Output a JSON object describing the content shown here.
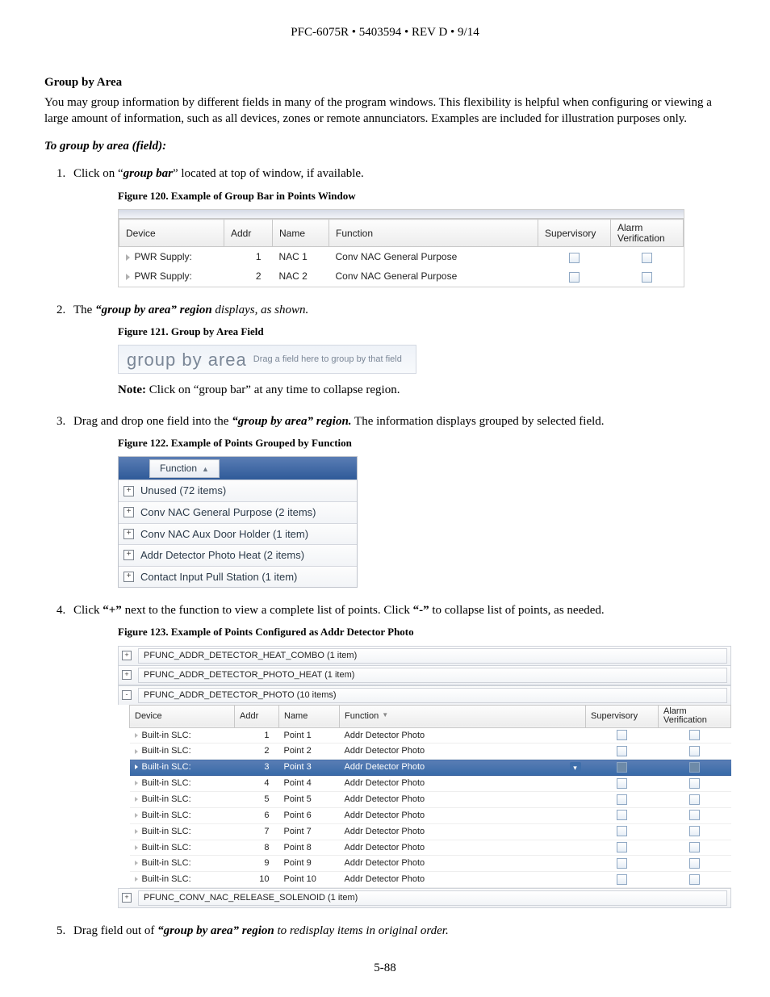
{
  "header": "PFC-6075R • 5403594 • REV D • 9/14",
  "section_title": "Group by Area",
  "intro_para": "You may group information by different fields in many of the program windows. This flexibility is helpful when configuring or viewing a large amount of information, such as all devices, zones or remote annunciators. Examples are included for illustration purposes only.",
  "subheading": "To group by area (field):",
  "step1_a": "Click on “",
  "step1_b": "group bar",
  "step1_c": "” located at top of window, if available.",
  "fig120_title": "Figure 120. Example of Group Bar in Points Window",
  "fig120": {
    "cols": [
      "Device",
      "Addr",
      "Name",
      "Function",
      "Supervisory",
      "Alarm Verification"
    ],
    "rows": [
      {
        "device": "PWR Supply:",
        "addr": "1",
        "name": "NAC 1",
        "function": "Conv NAC General Purpose"
      },
      {
        "device": "PWR Supply:",
        "addr": "2",
        "name": "NAC 2",
        "function": "Conv NAC General Purpose"
      }
    ]
  },
  "step2_a": "The ",
  "step2_b": "“group by area” region",
  "step2_c": " displays, as shown.",
  "fig121_title": "Figure 121. Group by Area Field",
  "fig121_big": "group by area",
  "fig121_small": "Drag a field here to group by that field",
  "note_prefix": "Note:",
  "note_text": " Click on “group bar” at any time to collapse region.",
  "step3_a": "Drag and drop one field into the ",
  "step3_b": "“group by area” region.",
  "step3_c": " The information displays grouped by selected field.",
  "fig122_title": "Figure 122. Example of Points Grouped by Function",
  "fig122": {
    "chip": "Function",
    "rows": [
      "Unused (72 items)",
      "Conv NAC General Purpose (2 items)",
      "Conv NAC Aux Door Holder (1 item)",
      "Addr Detector Photo Heat (2 items)",
      "Contact Input Pull Station (1 item)"
    ]
  },
  "step4_a": "Click ",
  "step4_plus": "“+”",
  "step4_b": " next to the function to view a complete list of points. Click ",
  "step4_minus": "“-”",
  "step4_c": " to collapse list of points, as needed.",
  "fig123_title": "Figure 123. Example of Points Configured as Addr Detector Photo",
  "fig123": {
    "groups_top": [
      "PFUNC_ADDR_DETECTOR_HEAT_COMBO (1 item)",
      "PFUNC_ADDR_DETECTOR_PHOTO_HEAT (1 item)"
    ],
    "open_group": "PFUNC_ADDR_DETECTOR_PHOTO (10 items)",
    "cols": [
      "Device",
      "Addr",
      "Name",
      "Function",
      "Supervisory",
      "Alarm Verification"
    ],
    "rows": [
      {
        "device": "Built-in SLC:",
        "addr": "1",
        "name": "Point 1",
        "function": "Addr Detector Photo",
        "sel": false
      },
      {
        "device": "Built-in SLC:",
        "addr": "2",
        "name": "Point 2",
        "function": "Addr Detector Photo",
        "sel": false
      },
      {
        "device": "Built-in SLC:",
        "addr": "3",
        "name": "Point 3",
        "function": "Addr Detector Photo",
        "sel": true
      },
      {
        "device": "Built-in SLC:",
        "addr": "4",
        "name": "Point 4",
        "function": "Addr Detector Photo",
        "sel": false
      },
      {
        "device": "Built-in SLC:",
        "addr": "5",
        "name": "Point 5",
        "function": "Addr Detector Photo",
        "sel": false
      },
      {
        "device": "Built-in SLC:",
        "addr": "6",
        "name": "Point 6",
        "function": "Addr Detector Photo",
        "sel": false
      },
      {
        "device": "Built-in SLC:",
        "addr": "7",
        "name": "Point 7",
        "function": "Addr Detector Photo",
        "sel": false
      },
      {
        "device": "Built-in SLC:",
        "addr": "8",
        "name": "Point 8",
        "function": "Addr Detector Photo",
        "sel": false
      },
      {
        "device": "Built-in SLC:",
        "addr": "9",
        "name": "Point 9",
        "function": "Addr Detector Photo",
        "sel": false
      },
      {
        "device": "Built-in SLC:",
        "addr": "10",
        "name": "Point 10",
        "function": "Addr Detector Photo",
        "sel": false
      }
    ],
    "group_bottom": "PFUNC_CONV_NAC_RELEASE_SOLENOID (1 item)"
  },
  "step5_a": "Drag field out of ",
  "step5_b": "“group by area” region",
  "step5_c": " to redisplay items in original order.",
  "page_foot": "5-88"
}
